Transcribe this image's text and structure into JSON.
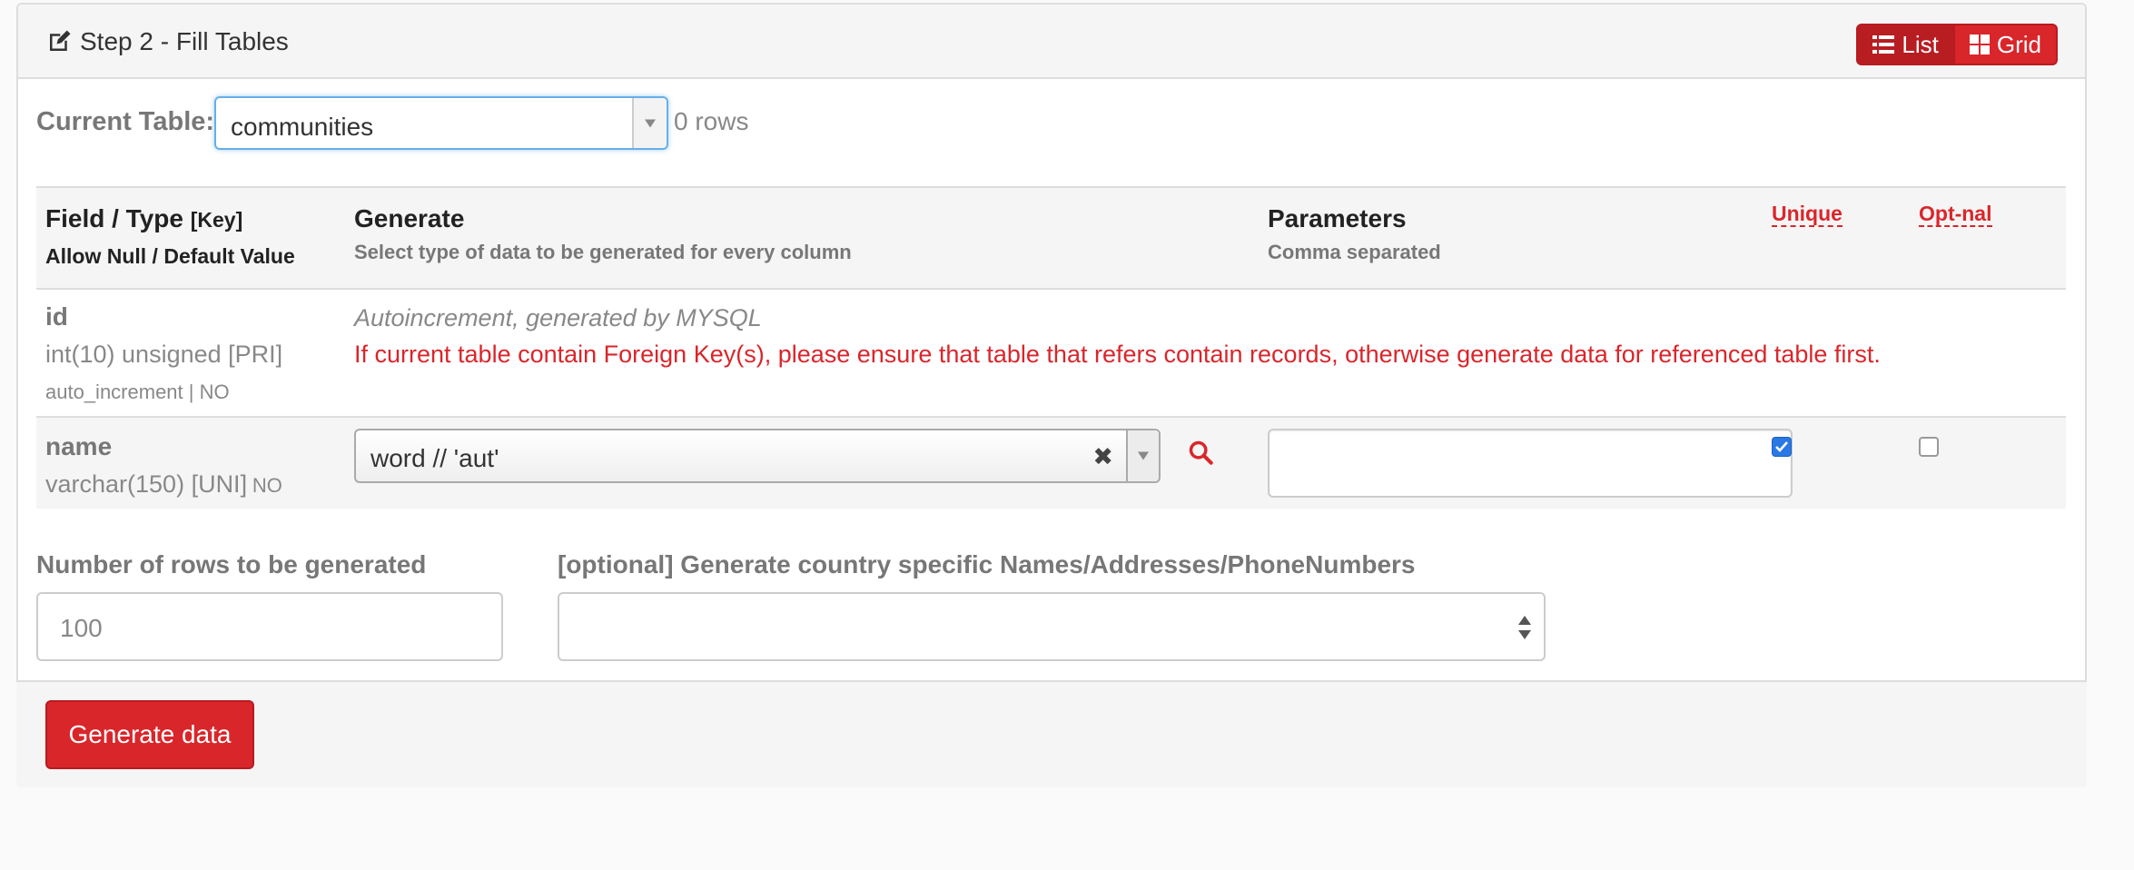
{
  "header": {
    "title": "Step 2 - Fill Tables",
    "view_list_label": "List",
    "view_grid_label": "Grid"
  },
  "current_table": {
    "label": "Current Table:",
    "selected": "communities",
    "row_count": "0 rows"
  },
  "columns": {
    "field_type": "Field / Type",
    "key": "[Key]",
    "allow_null": "Allow Null / Default Value",
    "generate": "Generate",
    "generate_sub": "Select type of data to be generated for every column",
    "parameters": "Parameters",
    "parameters_sub": "Comma separated",
    "unique": "Unique",
    "optional": "Opt-nal"
  },
  "rows": [
    {
      "name": "id",
      "type": "int(10) unsigned [PRI]",
      "null_default": "auto_increment | NO",
      "note": "Autoincrement, generated by MYSQL",
      "warning": "If current table contain Foreign Key(s), please ensure that table that refers contain records, otherwise generate data for referenced table first."
    },
    {
      "name": "name",
      "type": "varchar(150) [UNI]",
      "null_default": "| NO",
      "generator": "word // 'aut'",
      "parameters": "",
      "unique": true,
      "optional": false
    }
  ],
  "rows_to_generate": {
    "label": "Number of rows to be generated",
    "value": "100"
  },
  "country": {
    "label": "[optional] Generate country specific Names/Addresses/PhoneNumbers",
    "selected": ""
  },
  "footer": {
    "generate_button": "Generate data"
  },
  "colors": {
    "accent": "#d9262b",
    "checkbox": "#2a78e4"
  }
}
